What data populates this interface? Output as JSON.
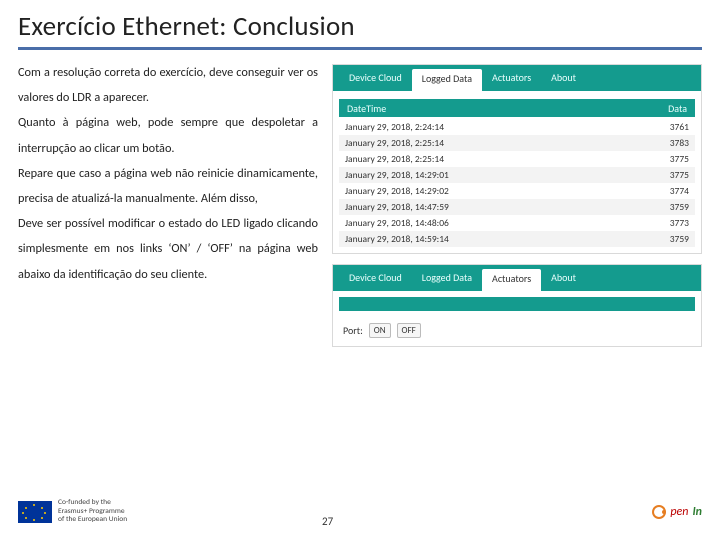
{
  "title": "Exercício Ethernet: Conclusion",
  "paragraphs": [
    "Com a resolução correta do exercício, deve conseguir ver os valores do LDR a aparecer.",
    "Quanto à página web, pode sempre que despoletar a interrupção ao clicar um botão.",
    "Repare que caso a página web não reinicie dinamicamente, precisa de atualizá-la manualmente. Além disso,",
    "Deve ser possível modificar o estado do LED ligado clicando simplesmente em nos links ‘ON’ / ‘OFF’ na página web abaixo da identificação do seu cliente."
  ],
  "tabs": [
    "Device Cloud",
    "Logged Data",
    "Actuators",
    "About"
  ],
  "panel1": {
    "activeTab": "Logged Data",
    "headers": {
      "c1": "DateTime",
      "c2": "Data"
    },
    "rows": [
      {
        "dt": "January 29, 2018, 2:24:14",
        "val": "3761"
      },
      {
        "dt": "January 29, 2018, 2:25:14",
        "val": "3783"
      },
      {
        "dt": "January 29, 2018, 2:25:14",
        "val": "3775"
      },
      {
        "dt": "January 29, 2018, 14:29:01",
        "val": "3775"
      },
      {
        "dt": "January 29, 2018, 14:29:02",
        "val": "3774"
      },
      {
        "dt": "January 29, 2018, 14:47:59",
        "val": "3759"
      },
      {
        "dt": "January 29, 2018, 14:48:06",
        "val": "3773"
      },
      {
        "dt": "January 29, 2018, 14:59:14",
        "val": "3759"
      }
    ]
  },
  "panel2": {
    "activeTab": "Actuators",
    "portLabel": "Port:",
    "onLabel": "ON",
    "offLabel": "OFF"
  },
  "footer": {
    "euLine1": "Co-funded by the",
    "euLine2": "Erasmus+ Programme",
    "euLine3": "of the European Union",
    "pageNumber": "27",
    "brandA": "pen",
    "brandB": "In"
  }
}
